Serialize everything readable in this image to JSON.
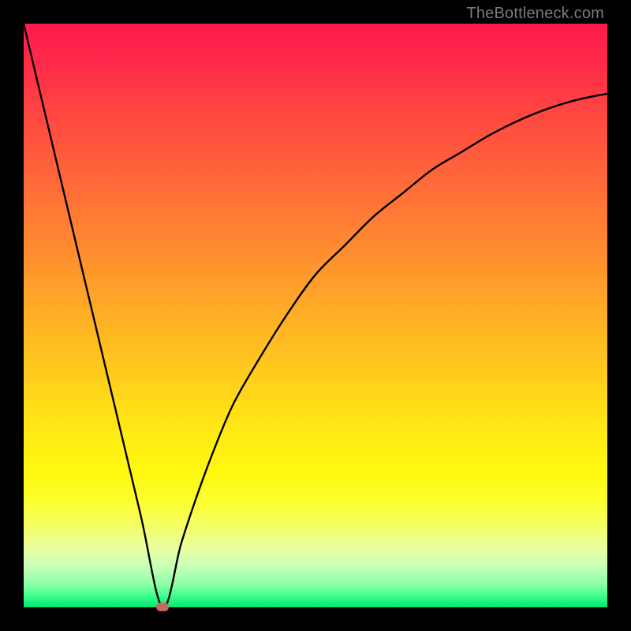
{
  "watermark": "TheBottleneck.com",
  "colors": {
    "frame": "#000000",
    "curve": "#000000",
    "marker": "#c5695e"
  },
  "chart_data": {
    "type": "line",
    "title": "",
    "xlabel": "",
    "ylabel": "",
    "xlim": [
      0,
      100
    ],
    "ylim": [
      0,
      100
    ],
    "grid": false,
    "series": [
      {
        "name": "bottleneck-curve",
        "x": [
          0,
          5,
          10,
          15,
          20,
          23.8,
          27,
          30,
          33,
          36,
          40,
          45,
          50,
          55,
          60,
          65,
          70,
          75,
          80,
          85,
          90,
          95,
          100
        ],
        "values": [
          100,
          79,
          58,
          37,
          16,
          0,
          11,
          20,
          28,
          35,
          42,
          50,
          57,
          62,
          67,
          71,
          75,
          78,
          81,
          83.5,
          85.5,
          87,
          88
        ]
      }
    ],
    "markers": [
      {
        "name": "optimal-point",
        "x": 23.8,
        "y": 0
      }
    ],
    "background_gradient": {
      "type": "vertical",
      "stops": [
        {
          "pos": 0,
          "color": "#ff1a4d"
        },
        {
          "pos": 50,
          "color": "#ffba22"
        },
        {
          "pos": 80,
          "color": "#fcff30"
        },
        {
          "pos": 100,
          "color": "#00e676"
        }
      ]
    }
  }
}
